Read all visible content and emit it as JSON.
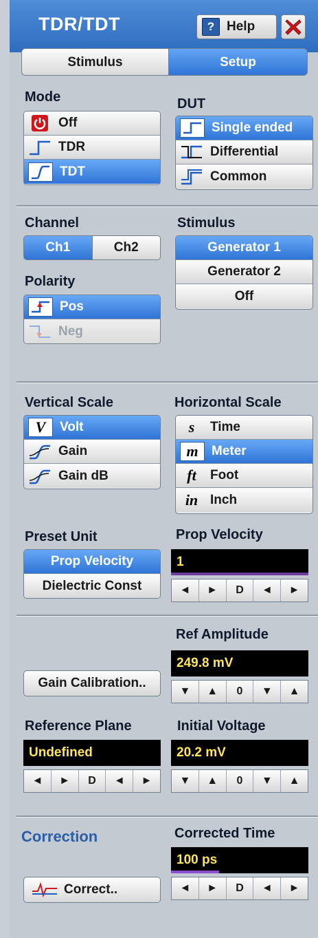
{
  "window": {
    "title": "TDR/TDT",
    "help_label": "Help",
    "help_glyph": "?"
  },
  "tabs": [
    {
      "label": "Stimulus",
      "active": false
    },
    {
      "label": "Setup",
      "active": true
    }
  ],
  "mode": {
    "label": "Mode",
    "options": [
      "Off",
      "TDR",
      "TDT"
    ],
    "selected": "TDT"
  },
  "dut": {
    "label": "DUT",
    "options": [
      "Single ended",
      "Differential",
      "Common"
    ],
    "selected": "Single ended"
  },
  "channel": {
    "label": "Channel",
    "options": [
      "Ch1",
      "Ch2"
    ],
    "selected": "Ch1"
  },
  "stimulus": {
    "label": "Stimulus",
    "options": [
      "Generator 1",
      "Generator 2",
      "Off"
    ],
    "selected": "Generator 1"
  },
  "polarity": {
    "label": "Polarity",
    "options": [
      "Pos",
      "Neg"
    ],
    "selected": "Pos",
    "disabled": [
      "Neg"
    ]
  },
  "vertical_scale": {
    "label": "Vertical Scale",
    "options": [
      {
        "icon": "V",
        "label": "Volt"
      },
      {
        "icon": "step",
        "label": "Gain"
      },
      {
        "icon": "step",
        "label": "Gain dB"
      }
    ],
    "selected": "Volt"
  },
  "horizontal_scale": {
    "label": "Horizontal Scale",
    "options": [
      {
        "icon": "s",
        "label": "Time"
      },
      {
        "icon": "m",
        "label": "Meter"
      },
      {
        "icon": "ft",
        "label": "Foot"
      },
      {
        "icon": "in",
        "label": "Inch"
      }
    ],
    "selected": "Meter"
  },
  "preset_unit": {
    "label": "Preset Unit",
    "options": [
      "Prop Velocity",
      "Dielectric Const"
    ],
    "selected": "Prop Velocity"
  },
  "prop_velocity": {
    "label": "Prop Velocity",
    "value": "1",
    "spin": [
      "◄",
      "►",
      "D",
      "◄",
      "►"
    ]
  },
  "ref_amplitude": {
    "label": "Ref Amplitude",
    "value": "249.8 mV",
    "spin": [
      "▼",
      "▲",
      "0",
      "▼",
      "▲"
    ]
  },
  "gain_calibration": {
    "label": "Gain Calibration.."
  },
  "reference_plane": {
    "label": "Reference Plane",
    "value": "Undefined",
    "spin": [
      "◄",
      "►",
      "D",
      "◄",
      "►"
    ]
  },
  "initial_voltage": {
    "label": "Initial Voltage",
    "value": "20.2 mV",
    "spin": [
      "▼",
      "▲",
      "0",
      "▼",
      "▲"
    ]
  },
  "correction": {
    "label": "Correction",
    "button_label": "Correct.."
  },
  "corrected_time": {
    "label": "Corrected Time",
    "value": "100 ps",
    "spin": [
      "◄",
      "►",
      "D",
      "◄",
      "►"
    ],
    "level": 0.35
  },
  "colors": {
    "accent": "#2f74d6",
    "title_bar": "#3f7ccd",
    "value_text": "#ffe45c",
    "value_bar": "#8a4fd0",
    "close_x": "#d0161a"
  }
}
